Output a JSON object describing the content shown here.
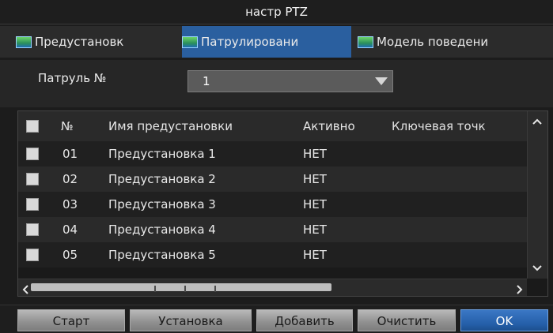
{
  "window": {
    "title": "настр PTZ"
  },
  "tabs": [
    {
      "label": "Предустановк"
    },
    {
      "label": "Патрулировани"
    },
    {
      "label": "Модель поведени"
    }
  ],
  "patrol": {
    "label": "Патруль №",
    "selected": "1"
  },
  "table": {
    "columns": [
      "№",
      "Имя предустановки",
      "Активно",
      "Ключевая точк"
    ],
    "rows": [
      {
        "num": "01",
        "name": "Предустановка 1",
        "active": "НЕТ"
      },
      {
        "num": "02",
        "name": "Предустановка 2",
        "active": "НЕТ"
      },
      {
        "num": "03",
        "name": "Предустановка 3",
        "active": "НЕТ"
      },
      {
        "num": "04",
        "name": "Предустановка 4",
        "active": "НЕТ"
      },
      {
        "num": "05",
        "name": "Предустановка 5",
        "active": "НЕТ"
      }
    ]
  },
  "buttons": {
    "start": "Старт",
    "setup": "Установка",
    "add": "Добавить",
    "clear": "Очистить",
    "ok": "OK"
  }
}
